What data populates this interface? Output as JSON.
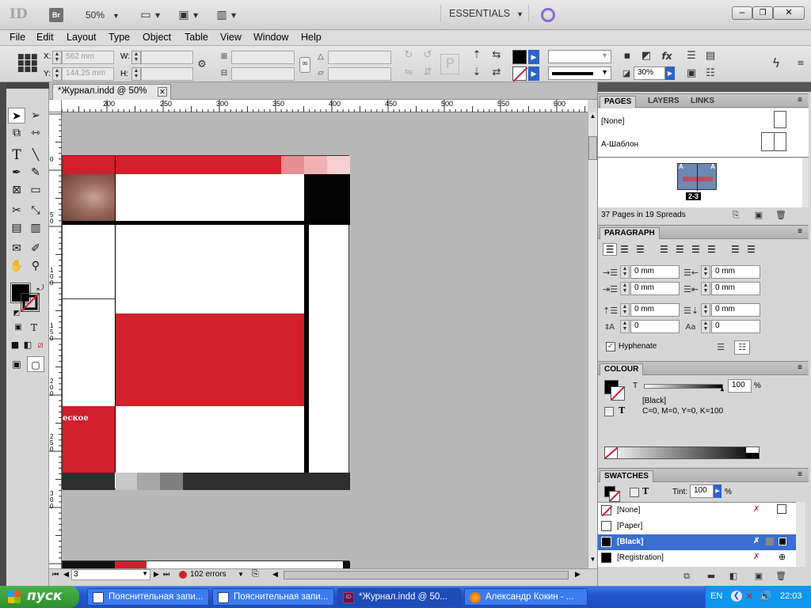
{
  "app": {
    "logo": "ID",
    "bridge": "Br",
    "zoom": "50%",
    "workspace": "ESSENTIALS"
  },
  "menu": [
    "File",
    "Edit",
    "Layout",
    "Type",
    "Object",
    "Table",
    "View",
    "Window",
    "Help"
  ],
  "control": {
    "x_label": "X:",
    "x_value": "562 mm",
    "y_label": "Y:",
    "y_value": "144,25 mm",
    "w_label": "W:",
    "h_label": "H:",
    "opacity": "30%"
  },
  "document": {
    "tab_title": "*Журнал.indd @ 50%",
    "ruler_top": [
      "200",
      "250",
      "300",
      "350",
      "400",
      "450",
      "500",
      "550",
      "600"
    ],
    "ruler_left": [
      "0",
      "5 0",
      "1 0 0",
      "1 5 0",
      "2 0 0",
      "2 5 0",
      "3 0 0"
    ],
    "page_text": "еское"
  },
  "status": {
    "page": "3",
    "errors": "102 errors"
  },
  "pages_panel": {
    "tabs": [
      "PAGES",
      "LAYERS",
      "LINKS"
    ],
    "none_master": "[None]",
    "a_master": "A-Шаблон",
    "spread_label": "2-3",
    "master_letter": "A",
    "summary": "37 Pages in 19 Spreads"
  },
  "paragraph_panel": {
    "title": "PARAGRAPH",
    "left_indent": "0 mm",
    "right_indent": "0 mm",
    "first_indent": "0 mm",
    "last_indent": "0 mm",
    "space_before": "0 mm",
    "space_after": "0 mm",
    "drop_lines": "0",
    "drop_chars": "0",
    "hyphenate": "Hyphenate"
  },
  "colour_panel": {
    "title": "COLOUR",
    "tint_label": "T",
    "tint": "100",
    "percent": "%",
    "name": "[Black]",
    "cmyk": "C=0, M=0, Y=0, K=100"
  },
  "swatches_panel": {
    "title": "SWATCHES",
    "tint_label": "Tint:",
    "tint": "100",
    "percent": "%",
    "items": [
      {
        "name": "[None]"
      },
      {
        "name": "[Paper]"
      },
      {
        "name": "[Black]"
      },
      {
        "name": "[Registration]"
      }
    ]
  },
  "colors": {
    "accent_red": "#d0202b",
    "selection_blue": "#3a6fd0"
  },
  "taskbar": {
    "start": "пуск",
    "tasks": [
      "Пояснительная запи...",
      "Пояснительная запи...",
      "*Журнал.indd @ 50...",
      "Александр Кокин - ..."
    ],
    "lang": "EN",
    "time": "22:03"
  }
}
